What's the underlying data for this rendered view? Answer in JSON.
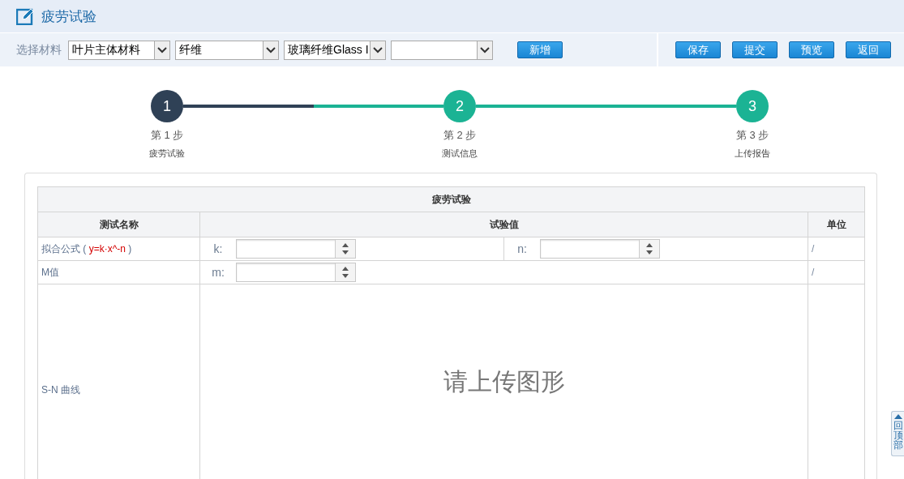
{
  "header": {
    "title": "疲劳试验"
  },
  "toolbar": {
    "label": "选择材料",
    "selects": [
      {
        "kind": "filled",
        "value": "叶片主体材料"
      },
      {
        "kind": "filled",
        "value": "纤维"
      },
      {
        "kind": "filled",
        "value": "玻璃纤维Glass I"
      },
      {
        "kind": "blank"
      }
    ],
    "add_button": "新增",
    "actions": [
      "保存",
      "提交",
      "预览",
      "返回"
    ]
  },
  "stepper": {
    "progress": {
      "level": 0.5
    },
    "steps": [
      {
        "number": "1",
        "title": "第 1 步",
        "subtitle": "疲劳试验",
        "active": true
      },
      {
        "number": "2",
        "title": "第 2 步",
        "subtitle": "测试信息",
        "active": false
      },
      {
        "number": "3",
        "title": "第 3 步",
        "subtitle": "上传报告",
        "active": false
      }
    ]
  },
  "table": {
    "title": "疲劳试验",
    "columns": [
      "测试名称",
      "试验值",
      "单位"
    ],
    "rows": [
      {
        "kind": "formula",
        "name_prefix": "拟合公式 (",
        "formula": "y=k·x^-n",
        "name_suffix": ")",
        "fields": [
          {
            "label": "k:"
          },
          {
            "label": "n:"
          }
        ],
        "unit": "/"
      },
      {
        "kind": "fields",
        "name": "M值",
        "fields": [
          {
            "label": "m:"
          }
        ],
        "unit": "/"
      },
      {
        "kind": "upload",
        "name": "S-N 曲线",
        "placeholder": "请上传图形"
      }
    ]
  },
  "back_to_top": {
    "label": "回顶部"
  }
}
